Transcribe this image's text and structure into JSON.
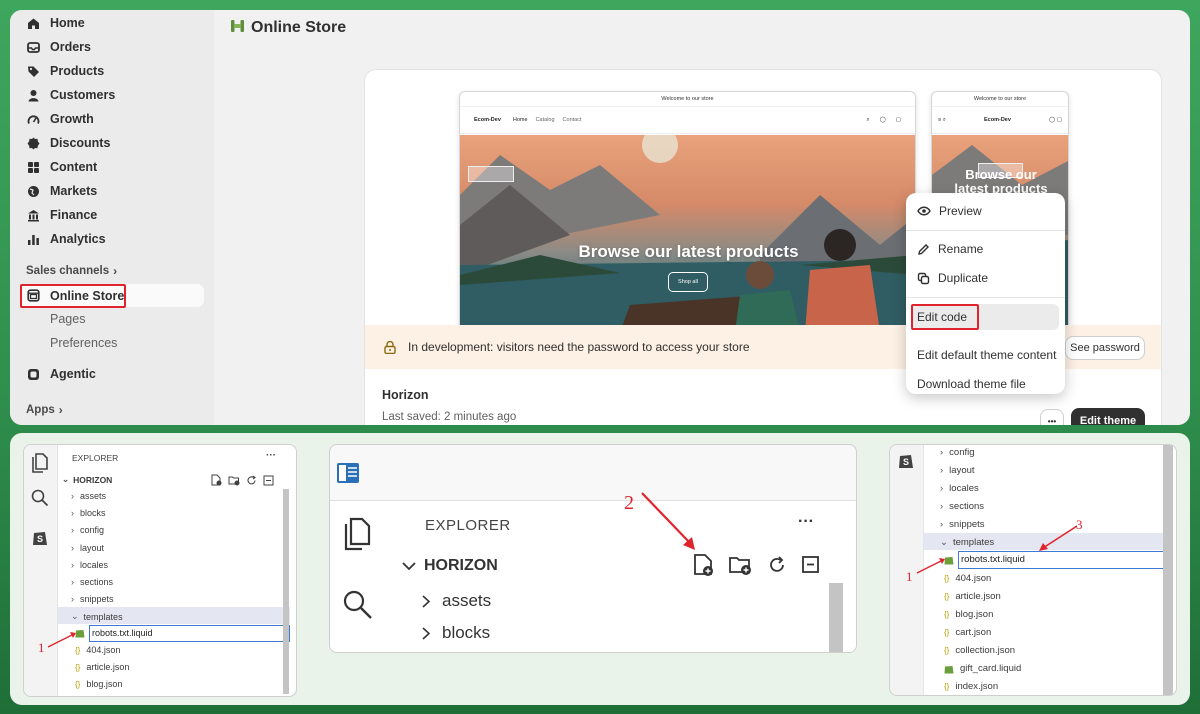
{
  "sidebar": {
    "items": [
      {
        "label": "Home",
        "icon": "home-icon"
      },
      {
        "label": "Orders",
        "icon": "inbox-icon"
      },
      {
        "label": "Products",
        "icon": "tag-icon"
      },
      {
        "label": "Customers",
        "icon": "person-icon"
      },
      {
        "label": "Growth",
        "icon": "gauge-icon"
      },
      {
        "label": "Discounts",
        "icon": "discount-icon"
      },
      {
        "label": "Content",
        "icon": "content-icon"
      },
      {
        "label": "Markets",
        "icon": "globe-icon"
      },
      {
        "label": "Finance",
        "icon": "bank-icon"
      },
      {
        "label": "Analytics",
        "icon": "bar-chart-icon"
      }
    ],
    "sales_channels_label": "Sales channels",
    "online_store_label": "Online Store",
    "sub_items": [
      "Pages",
      "Preferences"
    ],
    "agentic_label": "Agentic",
    "apps_label": "Apps"
  },
  "main": {
    "title": "Online Store",
    "preview_desktop": {
      "announcement": "Welcome to our store",
      "brand": "Ecom-Dev",
      "links": [
        "Home",
        "Catalog",
        "Contact"
      ],
      "headline": "Browse our latest products",
      "button": "Shop all"
    },
    "preview_mobile": {
      "announcement": "Welcome to our store",
      "brand": "Ecom-Dev",
      "headline_line1": "Browse our",
      "headline_line2": "latest products"
    },
    "dev_notice": "In development: visitors need the password to access your store",
    "see_password": "See password",
    "theme_name": "Horizon",
    "last_saved": "Last saved: 2 minutes ago",
    "more_label": "•••",
    "edit_theme": "Edit theme"
  },
  "context_menu": {
    "preview": "Preview",
    "rename": "Rename",
    "duplicate": "Duplicate",
    "edit_code": "Edit code",
    "edit_default": "Edit default theme content",
    "download": "Download theme file"
  },
  "panel1": {
    "explorer": "EXPLORER",
    "dots": "···",
    "root": "HORIZON",
    "folders": [
      "assets",
      "blocks",
      "config",
      "layout",
      "locales",
      "sections",
      "snippets"
    ],
    "open_folder": "templates",
    "new_file": "robots.txt.liquid",
    "files": [
      "404.json",
      "article.json",
      "blog.json"
    ],
    "step": "1"
  },
  "panel2": {
    "explorer": "EXPLORER",
    "dots": "···",
    "root": "HORIZON",
    "folders": [
      "assets",
      "blocks"
    ],
    "step": "2"
  },
  "panel3": {
    "folders": [
      "config",
      "layout",
      "locales",
      "sections",
      "snippets"
    ],
    "open_folder": "templates",
    "new_file": "robots.txt.liquid",
    "files": [
      "404.json",
      "article.json",
      "blog.json",
      "cart.json",
      "collection.json",
      "gift_card.liquid",
      "index.json"
    ],
    "step1": "1",
    "step3": "3"
  },
  "colors": {
    "accent_red": "#e0242d",
    "shopify_green": "#5e8e3e",
    "dark_button": "#303030"
  }
}
